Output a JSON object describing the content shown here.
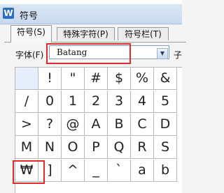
{
  "window": {
    "title": "符号",
    "icon_glyph": "W"
  },
  "tabs": [
    {
      "label": "符号(S)"
    },
    {
      "label": "特殊字符(P)"
    },
    {
      "label": "符号栏(T)"
    }
  ],
  "font": {
    "label": "字体(F)",
    "value": "Batang",
    "subset_label_partial": "子"
  },
  "grid_rows": [
    [
      "",
      "!",
      "\"",
      "#",
      "$",
      "%",
      "&"
    ],
    [
      "/",
      "0",
      "1",
      "2",
      "3",
      "4",
      "5"
    ],
    [
      ">",
      "?",
      "@",
      "A",
      "B",
      "C",
      "D"
    ],
    [
      "M",
      "N",
      "O",
      "P",
      "Q",
      "R",
      "S"
    ],
    [
      "₩",
      "]",
      "^",
      "_",
      "`",
      "a",
      "b"
    ]
  ],
  "highlight_color": "#e12b2b"
}
